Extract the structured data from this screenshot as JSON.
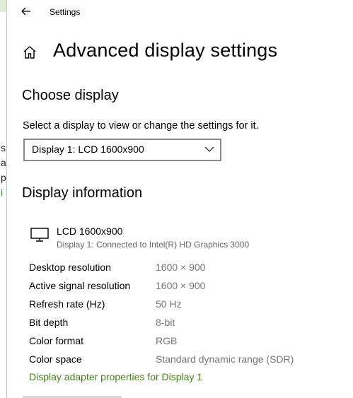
{
  "background_window": {
    "fragments": [
      "s",
      "a",
      "p",
      "i"
    ]
  },
  "window": {
    "app_title": "Settings"
  },
  "page": {
    "title": "Advanced display settings"
  },
  "choose_display": {
    "heading": "Choose display",
    "description": "Select a display to view or change the settings for it.",
    "selected": "Display 1: LCD 1600x900"
  },
  "display_info": {
    "heading": "Display information",
    "monitor_name": "LCD 1600x900",
    "monitor_sub": "Display 1: Connected to Intel(R) HD Graphics 3000",
    "rows": [
      {
        "label": "Desktop resolution",
        "value": "1600 × 900"
      },
      {
        "label": "Active signal resolution",
        "value": "1600 × 900"
      },
      {
        "label": "Refresh rate (Hz)",
        "value": "50 Hz"
      },
      {
        "label": "Bit depth",
        "value": "8-bit"
      },
      {
        "label": "Color format",
        "value": "RGB"
      },
      {
        "label": "Color space",
        "value": "Standard dynamic range (SDR)"
      }
    ],
    "adapter_link": "Display adapter properties for Display 1"
  },
  "colors": {
    "link": "#4a7c1e",
    "secondary_text": "#767676",
    "background_window_accent": "#e3ecd6"
  }
}
